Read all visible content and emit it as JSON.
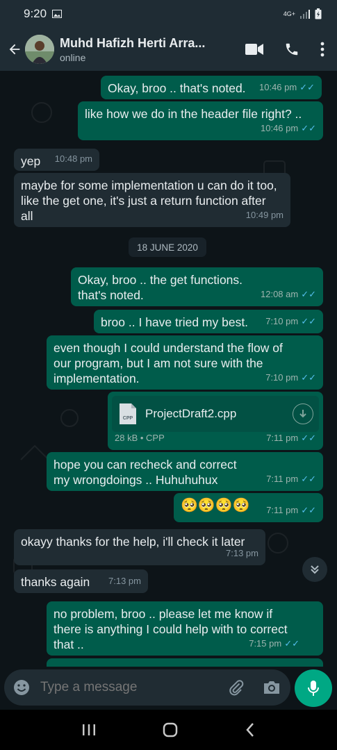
{
  "status_bar": {
    "time": "9:20",
    "network": "4G+"
  },
  "header": {
    "contact_name": "Muhd Hafizh Herti Arra...",
    "status": "online"
  },
  "date_chip": "18 JUNE 2020",
  "messages": [
    {
      "dir": "out",
      "text": "Okay, broo .. that's noted.",
      "time": "10:46 pm"
    },
    {
      "dir": "out",
      "text": "like how we do in the header file right? ..",
      "time": "10:46 pm"
    },
    {
      "dir": "in",
      "text": "yep",
      "time": "10:48 pm"
    },
    {
      "dir": "in",
      "text": "maybe for some implementation u can do it too, like the get one, it's just a return function after all",
      "time": "10:49 pm"
    },
    {
      "dir": "out",
      "text": "Okay, broo .. the get functions. that's noted.",
      "time": "12:08 am"
    },
    {
      "dir": "out",
      "text": "broo .. I have tried my best.",
      "time": "7:10 pm"
    },
    {
      "dir": "out",
      "text": "even though I could understand the flow of our program, but I am not sure with the implementation.",
      "time": "7:10 pm"
    },
    {
      "dir": "out",
      "type": "file",
      "file_name": "ProjectDraft2.cpp",
      "file_type_badge": "CPP",
      "file_info": "28 kB • CPP",
      "time": "7:11 pm"
    },
    {
      "dir": "out",
      "text": "hope you can recheck and correct my wrongdoings .. Huhuhuhux",
      "time": "7:11 pm"
    },
    {
      "dir": "out",
      "text": "🥺🥺🥺🥺",
      "time": "7:11 pm"
    },
    {
      "dir": "in",
      "text": "okayy thanks for the help, i'll check it later",
      "time": "7:13 pm"
    },
    {
      "dir": "in",
      "text": "thanks again",
      "time": "7:13 pm"
    },
    {
      "dir": "out",
      "text": "no problem, broo .. please let me know if there is anything I could help with to correct that ..",
      "time": "7:15 pm"
    }
  ],
  "composer": {
    "placeholder": "Type a message"
  },
  "icons": {
    "back": "arrow-left-icon",
    "video": "video-call-icon",
    "call": "phone-icon",
    "menu": "more-vert-icon",
    "emoji": "emoji-icon",
    "attach": "paperclip-icon",
    "camera": "camera-icon",
    "mic": "mic-icon",
    "scroll_down": "double-chevron-down-icon",
    "read": "double-check-icon"
  },
  "colors": {
    "header": "#1f2c34",
    "outgoing": "#005c4b",
    "incoming": "#202c33",
    "accent": "#00a884",
    "read_ticks": "#53bdeb"
  }
}
